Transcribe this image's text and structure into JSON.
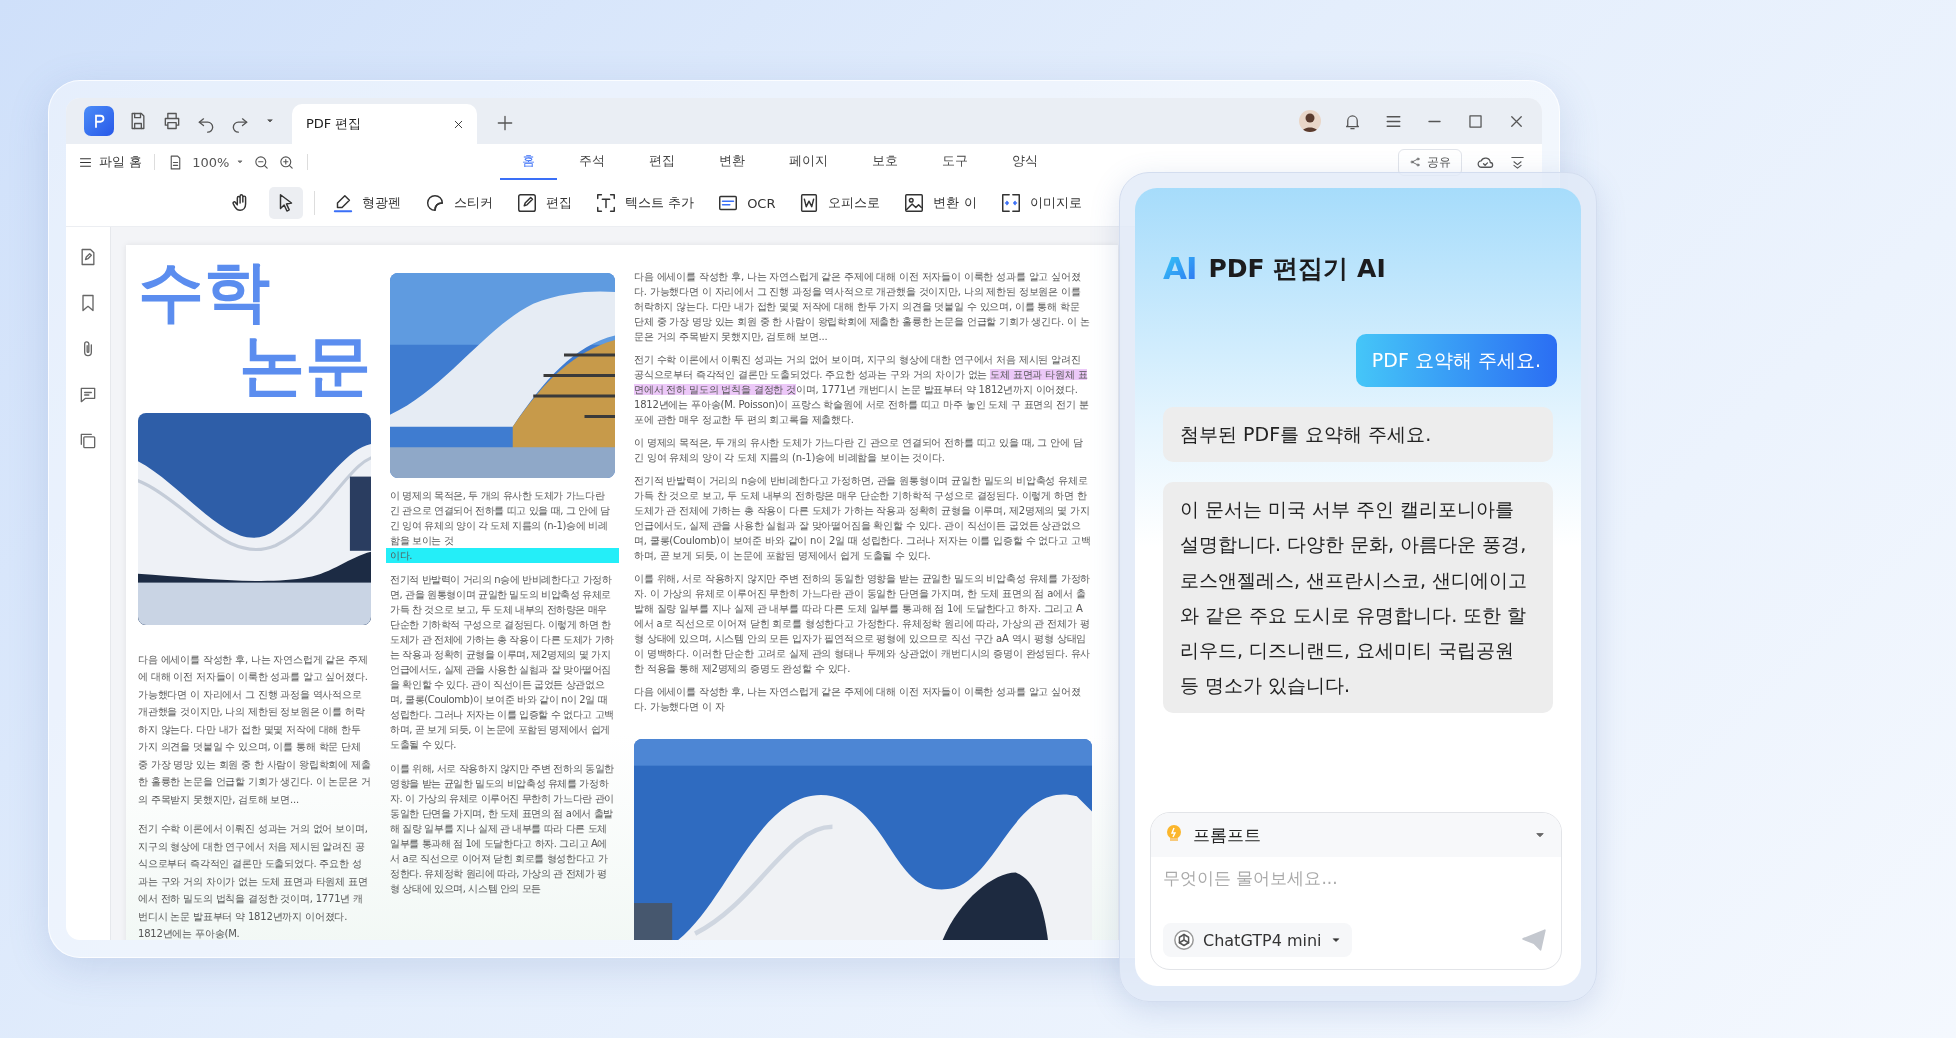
{
  "title_bar": {
    "tab": {
      "label": "PDF 편집"
    }
  },
  "menu_bar": {
    "file_menu": "파일 홈",
    "zoom": "100%",
    "share": "공유",
    "tabs": [
      {
        "label": "홈",
        "selected": true
      },
      {
        "label": "주석",
        "selected": false
      },
      {
        "label": "편집",
        "selected": false
      },
      {
        "label": "변환",
        "selected": false
      },
      {
        "label": "페이지",
        "selected": false
      },
      {
        "label": "보호",
        "selected": false
      },
      {
        "label": "도구",
        "selected": false
      },
      {
        "label": "양식",
        "selected": false
      }
    ]
  },
  "tools": [
    {
      "kind": "hand",
      "selected": false
    },
    {
      "kind": "pointer",
      "selected": true
    },
    {
      "kind": "highlighter",
      "label": "형광펜",
      "selected": false
    },
    {
      "kind": "sticker",
      "label": "스티커",
      "selected": false
    },
    {
      "kind": "edit",
      "label": "편집",
      "selected": false
    },
    {
      "kind": "text",
      "label": "텍스트 추가",
      "selected": false
    },
    {
      "kind": "ocr",
      "label": "OCR",
      "selected": false
    },
    {
      "kind": "office",
      "label": "오피스로",
      "selected": false
    },
    {
      "kind": "convert",
      "label": "변환 이",
      "selected": false
    },
    {
      "label": "이미지로",
      "selected": false
    }
  ],
  "document": {
    "columns": [
      {
        "blocks": [
          {
            "kind": "title",
            "lines": [
              "수학",
              "논문"
            ]
          },
          {
            "kind": "picture"
          },
          {
            "kind": "paragraph",
            "text": "다음 에세이를 작성한 후, 나는 자연스럽게 같은 주제에 대해 이전 저자들이 이룩한 성과를 알고 싶어졌다. 가능했다면 이 자리에서 그 진행 과정을 역사적으로 개관했을 것이지만, 나의 제한된 정보원은 이를 허락하지 않는다. 다만 내가 접한 몇몇 저작에 대해 한두 가지 의견을 덧붙일 수 있으며, 이를 통해 학문 단체 중 가장 명망 있는 회원 중 한 사람이 왕립학회에 제출한 훌륭한 논문을 언급할 기회가 생긴다. 이 논문은 거의 주목받지 못했지만, 검토해 보면..."
          },
          {
            "kind": "paragraph",
            "text": "전기 수학 이론에서 이뤄진 성과는 거의 없어 보이며, 지구의 형상에 대한 연구에서 처음 제시된 알려진 공식으로부터 즉각적인 결론만 도출되었다. 주요한 성과는 구와 거의 차이가 없는 도체 표면과 타원체 표면에서 전하 밀도의 법칙을 결정한 것이며, 1771년 캐번디시 논문 발표부터 약 1812년까지 이어졌다. 1812년에는 푸아송(M."
          }
        ]
      },
      {
        "blocks": [
          {
            "kind": "picture"
          },
          {
            "kind": "paragraph",
            "segments": [
              {
                "kind": "plain",
                "text": "이 명제의 목적은, 두 개의 유사한 도체가 가느다란 긴 관으로 연결되어 전하를 띠고 있을 때, 그 안에 담긴 잉여 유체의 양이 각 도체 지름의 (n-1)승에 비례함을 보이는 것"
              },
              {
                "kind": "band",
                "color": "#24eef8",
                "text": "이다."
              }
            ]
          },
          {
            "kind": "paragraph",
            "text": "전기적 반발력이 거리의 n승에 반비례한다고 가정하면, 관을 원통형이며 균일한 밀도의 비압축성 유체로 가득 찬 것으로 보고, 두 도체 내부의 전하량은 매우 단순한 기하학적 구성으로 결정된다. 이렇게 하면 한 도체가 관 전체에 가하는 총 작용이 다른 도체가 가하는 작용과 정확히 균형을 이루며, 제2명제의 몇 가지 언급에서도, 실제 관을 사용한 실험과 잘 맞아떨어짐을 확인할 수 있다. 관이 직선이든 굽었든 상관없으며, 쿨롱(Coulomb)이 보여준 바와 같이 n이 2일 때 성립한다. 그러나 저자는 이를 입증할 수 없다고 고백하며, 곧 보게 되듯, 이 논문에 포함된 명제에서 쉽게 도출될 수 있다."
          },
          {
            "kind": "paragraph",
            "text": "이를 위해, 서로 작용하지 않지만 주변 전하의 동일한 영향을 받는 균일한 밀도의 비압축성 유체를 가정하자. 이 가상의 유체로 이루어진 무한히 가느다란 관이 동일한 단면을 가지며, 한 도체 표면의 점 a에서 출발해 질량 일부를 지나 실제 관 내부를 따라 다른 도체 일부를 통과해 점 1에 도달한다고 하자. 그리고 A에서 a로 직선으로 이어져 닫힌 회로를 형성한다고 가정한다. 유체정학 원리에 따라, 가상의 관 전체가 평형 상태에 있으며, 시스템 안의 모든"
          }
        ]
      },
      {
        "blocks": [
          {
            "kind": "paragraph",
            "text": "다음 에세이를 작성한 후, 나는 자연스럽게 같은 주제에 대해 이전 저자들이 이룩한 성과를 알고 싶어졌다. 가능했다면 이 자리에서 그 진행 과정을 역사적으로 개관했을 것이지만, 나의 제한된 정보원은 이를 허락하지 않는다. 다만 내가 접한 몇몇 저작에 대해 한두 가지 의견을 덧붙일 수 있으며, 이를 통해 학문 단체 중 가장 명망 있는 회원 중 한 사람이 왕립학회에 제출한 훌륭한 논문을 언급할 기회가 생긴다. 이 논문은 거의 주목받지 못했지만, 검토해 보면..."
          },
          {
            "kind": "paragraph",
            "segments": [
              {
                "kind": "plain",
                "text": "전기 수학 이론에서 이뤄진 성과는 거의 없어 보이며, 지구의 형상에 대한 연구에서 처음 제시된 알려진 공식으로부터 즉각적인 결론만 도출되었다. 주요한 성과는 구와 거의 차이가 없는 "
              },
              {
                "kind": "highlight",
                "color": "#ecc8f8",
                "text": "도체 표면과 타원체 표면에서 전하 밀도의 법칙을 결정한 것"
              },
              {
                "kind": "plain",
                "text": "이며, 1771년 캐번디시 논문 발표부터 약 1812년까지 이어졌다. 1812년에는 푸아송(M. Poisson)이 프랑스 학술원에 서로 전하를 띠고 마주 놓인 도체 구 표면의 전기 분포에 관한 매우 정교한 두 편의 회고록을 제출했다."
              }
            ]
          },
          {
            "kind": "paragraph",
            "text": "이 명제의 목적은, 두 개의 유사한 도체가 가느다란 긴 관으로 연결되어 전하를 띠고 있을 때, 그 안에 담긴 잉여 유체의 양이 각 도체 지름의 (n-1)승에 비례함을 보이는 것이다."
          },
          {
            "kind": "paragraph",
            "text": "전기적 반발력이 거리의 n승에 반비례한다고 가정하면, 관을 원통형이며 균일한 밀도의 비압축성 유체로 가득 찬 것으로 보고, 두 도체 내부의 전하량은 매우 단순한 기하학적 구성으로 결정된다. 이렇게 하면 한 도체가 관 전체에 가하는 총 작용이 다른 도체가 가하는 작용과 정확히 균형을 이루며, 제2명제의 몇 가지 언급에서도, 실제 관을 사용한 실험과 잘 맞아떨어짐을 확인할 수 있다. 관이 직선이든 굽었든 상관없으며, 쿨롱(Coulomb)이 보여준 바와 같이 n이 2일 때 성립한다. 그러나 저자는 이를 입증할 수 없다고 고백하며, 곧 보게 되듯, 이 논문에 포함된 명제에서 쉽게 도출될 수 있다."
          },
          {
            "kind": "paragraph",
            "text": "이를 위해, 서로 작용하지 않지만 주변 전하의 동일한 영향을 받는 균일한 밀도의 비압축성 유체를 가정하자. 이 가상의 유체로 이루어진 무한히 가느다란 관이 동일한 단면을 가지며, 한 도체 표면의 점 a에서 출발해 질량 일부를 지나 실제 관 내부를 따라 다른 도체 일부를 통과해 점 1에 도달한다고 하자. 그리고 A에서 a로 직선으로 이어져 닫힌 회로를 형성한다고 가정한다. 유체정학 원리에 따라, 가상의 관 전체가 평형 상태에 있으며, 시스템 안의 모든 입자가 필연적으로 평형에 있으므로 직선 구간 aA 역시 평형 상태임이 명백하다. 이러한 단순한 고려로 실제 관의 형태나 두께와 상관없이 캐번디시의 증명이 완성된다. 유사한 적용을 통해 제2명제의 증명도 완성할 수 있다."
          },
          {
            "kind": "paragraph",
            "text": "다음 에세이를 작성한 후, 나는 자연스럽게 같은 주제에 대해 이전 저자들이 이룩한 성과를 알고 싶어졌다. 가능했다면 이 자"
          },
          {
            "kind": "picture"
          }
        ]
      }
    ]
  },
  "ai_panel": {
    "logo": "AI",
    "title": "PDF 편집기 AI",
    "messages": [
      {
        "kind": "sent",
        "text": "PDF 요약해 주세요."
      },
      {
        "kind": "received",
        "text": "첨부된 PDF를 요약해 주세요."
      },
      {
        "kind": "received",
        "text": "이 문서는 미국 서부 주인 캘리포니아를 설명합니다. 다양한 문화, 아름다운 풍경, 로스앤젤레스, 샌프란시스코, 샌디에이고와 같은 주요 도시로 유명합니다. 또한 할리우드, 디즈니랜드, 요세미티 국립공원 등 명소가 있습니다."
      }
    ],
    "prompt_label": "프롬프트",
    "placeholder": "무엇이든 물어보세요...",
    "model": "ChatGTP4 mini"
  }
}
